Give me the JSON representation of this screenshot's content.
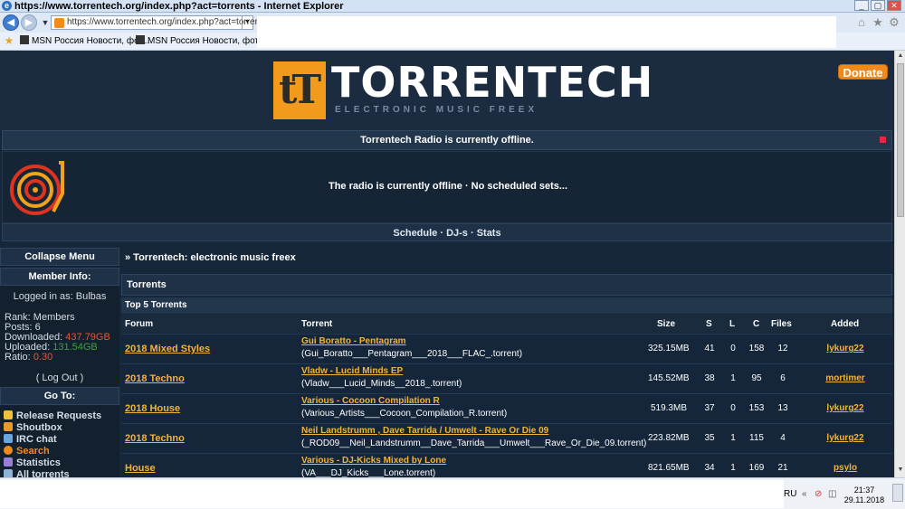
{
  "window": {
    "title": "https://www.torrentech.org/index.php?act=torrents - Internet Explorer",
    "url": "https://www.torrentech.org/index.php?act=torrents"
  },
  "favorites": [
    {
      "label": "MSN Россия  Новости, фот..."
    },
    {
      "label": "MSN Россия  Новости, фот..."
    }
  ],
  "site": {
    "logo_text": "TORRENTECH",
    "logo_sub": "ELECTRONIC MUSIC FREEX",
    "donate_label": "Donate"
  },
  "radio": {
    "status": "Torrentech Radio is currently offline.",
    "message": "The radio is currently offline · No scheduled sets...",
    "links": "Schedule · DJ-s · Stats"
  },
  "sidebar": {
    "collapse_label": "Collapse Menu",
    "member_info_label": "Member Info:",
    "logged_in": "Logged in as: Bulbas",
    "rank": "Rank: Members",
    "posts": "Posts: 6",
    "downloaded_label": "Downloaded:",
    "downloaded_value": "437.79GB",
    "uploaded_label": "Uploaded:",
    "uploaded_value": "131.54GB",
    "ratio_label": "Ratio:",
    "ratio_value": "0.30",
    "logout_label": "( Log Out )",
    "goto_label": "Go To:",
    "links": [
      {
        "label": "Release Requests",
        "color": "#f0c03a"
      },
      {
        "label": "Shoutbox",
        "color": "#e89b2a"
      },
      {
        "label": "IRC chat",
        "color": "#6aa6e0"
      },
      {
        "label": "Search",
        "color": "#f18a1c"
      },
      {
        "label": "Statistics",
        "color": "#9a7fd8"
      },
      {
        "label": "All torrents",
        "color": "#8fb3d8"
      }
    ]
  },
  "content": {
    "breadcrumb": "» Torrentech: electronic music freex",
    "section_title": "Torrents",
    "subsection_title": "Top 5 Torrents",
    "columns": {
      "forum": "Forum",
      "torrent": "Torrent",
      "size": "Size",
      "s": "S",
      "l": "L",
      "c": "C",
      "files": "Files",
      "added": "Added"
    },
    "rows": [
      {
        "forum": "2018 Mixed Styles",
        "name": "Gui Boratto - Pentagram",
        "file": "(Gui_Boratto___Pentagram___2018___FLAC_.torrent)",
        "size": "325.15MB",
        "s": "41",
        "l": "0",
        "c": "158",
        "files": "12",
        "added": "lykurg22"
      },
      {
        "forum": "2018 Techno",
        "name": "Vladw - Lucid Minds EP",
        "file": "(Vladw___Lucid_Minds__2018_.torrent)",
        "size": "145.52MB",
        "s": "38",
        "l": "1",
        "c": "95",
        "files": "6",
        "added": "mortimer"
      },
      {
        "forum": "2018 House",
        "name": "Various - Cocoon Compilation R",
        "file": "(Various_Artists___Cocoon_Compilation_R.torrent)",
        "size": "519.3MB",
        "s": "37",
        "l": "0",
        "c": "153",
        "files": "13",
        "added": "lykurg22"
      },
      {
        "forum": "2018 Techno",
        "name": "Neil Landstrumm , Dave Tarrida / Umwelt - Rave Or Die 09",
        "file": "(_ROD09__Neil_Landstrumm__Dave_Tarrida___Umwelt___Rave_Or_Die_09.torrent)",
        "size": "223.82MB",
        "s": "35",
        "l": "1",
        "c": "115",
        "files": "4",
        "added": "lykurg22"
      },
      {
        "forum": "House",
        "name": "Various - DJ-Kicks Mixed by Lone",
        "file": "(VA___DJ_Kicks___Lone.torrent)",
        "size": "821.65MB",
        "s": "34",
        "l": "1",
        "c": "169",
        "files": "21",
        "added": "psylo"
      }
    ]
  },
  "taskbar": {
    "lang": "RU",
    "time": "21:37",
    "date": "29.11.2018"
  }
}
